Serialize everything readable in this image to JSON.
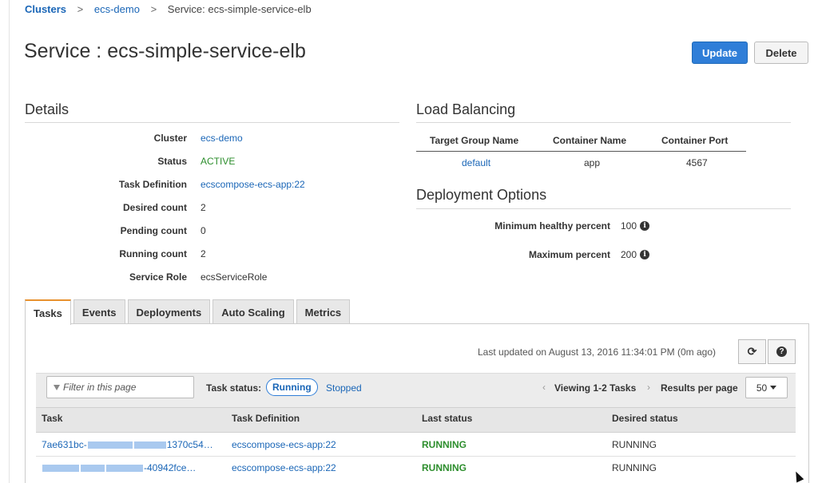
{
  "breadcrumb": {
    "root": "Clusters",
    "cluster": "ecs-demo",
    "current": "Service: ecs-simple-service-elb",
    "separator": ">"
  },
  "page": {
    "title": "Service : ecs-simple-service-elb",
    "update_label": "Update",
    "delete_label": "Delete"
  },
  "details": {
    "heading": "Details",
    "fields": [
      {
        "label": "Cluster",
        "value": "ecs-demo"
      },
      {
        "label": "Status",
        "value": "ACTIVE"
      },
      {
        "label": "Task Definition",
        "value": "ecscompose-ecs-app:22"
      },
      {
        "label": "Desired count",
        "value": "2"
      },
      {
        "label": "Pending count",
        "value": "0"
      },
      {
        "label": "Running count",
        "value": "2"
      },
      {
        "label": "Service Role",
        "value": "ecsServiceRole"
      }
    ]
  },
  "load_balancing": {
    "heading": "Load Balancing",
    "columns": [
      "Target Group Name",
      "Container Name",
      "Container Port"
    ],
    "row": [
      "default",
      "app",
      "4567"
    ]
  },
  "deployment": {
    "heading": "Deployment Options",
    "min_label": "Minimum healthy percent",
    "min_value": "100",
    "max_label": "Maximum percent",
    "max_value": "200"
  },
  "tabs": [
    "Tasks",
    "Events",
    "Deployments",
    "Auto Scaling",
    "Metrics"
  ],
  "tasks": {
    "last_updated": "Last updated on August 13, 2016 11:34:01 PM (0m ago)",
    "filter_placeholder": "Filter in this page",
    "task_status_label": "Task status:",
    "status_running": "Running",
    "status_stopped": "Stopped",
    "viewing": "Viewing 1-2 Tasks",
    "results_per_page_label": "Results per page",
    "results_per_page": "50",
    "columns": [
      "Task",
      "Task Definition",
      "Last status",
      "Desired status"
    ],
    "rows": [
      {
        "task_prefix": "7ae631bc-",
        "task_suffix": "1370c54…",
        "definition": "ecscompose-ecs-app:22",
        "last_status": "RUNNING",
        "desired_status": "RUNNING"
      },
      {
        "task_prefix": "",
        "task_suffix": "-40942fce…",
        "definition": "ecscompose-ecs-app:22",
        "last_status": "RUNNING",
        "desired_status": "RUNNING"
      }
    ]
  },
  "colors": {
    "link": "#1a66b7",
    "primary_button": "#2f7ed8",
    "status_green": "#2d8e2d",
    "tab_accent": "#e8912e"
  }
}
